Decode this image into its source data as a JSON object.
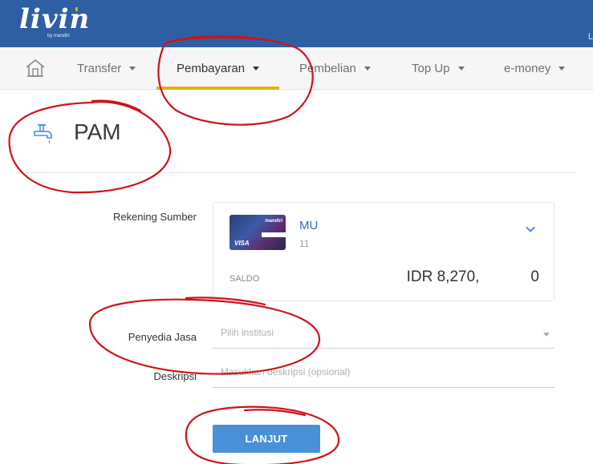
{
  "header": {
    "logo_text": "livin",
    "logo_quote": "'",
    "logo_sub": "by mandiri",
    "right_text": "L"
  },
  "nav": {
    "items": [
      {
        "label": "Transfer"
      },
      {
        "label": "Pembayaran"
      },
      {
        "label": "Pembelian"
      },
      {
        "label": "Top Up"
      },
      {
        "label": "e-money"
      }
    ],
    "active": "Pembayaran"
  },
  "page": {
    "title": "PAM"
  },
  "form": {
    "source_label": "Rekening Sumber",
    "account_name": "MU",
    "account_number": "11",
    "card_brand": "VISA",
    "card_bank": "mandiri",
    "saldo_label": "SALDO",
    "saldo_value": "IDR 8,270,",
    "saldo_tail": "0",
    "provider_label": "Penyedia Jasa",
    "provider_placeholder": "Pilih institusi",
    "desc_label": "Deskripsi",
    "desc_placeholder": "Masukkan deskripsi (opsional)",
    "submit_label": "LANJUT"
  },
  "colors": {
    "header": "#2f5fa3",
    "accent_underline": "#e0b20d",
    "button": "#4a90d6",
    "annotation": "#d0121b"
  }
}
